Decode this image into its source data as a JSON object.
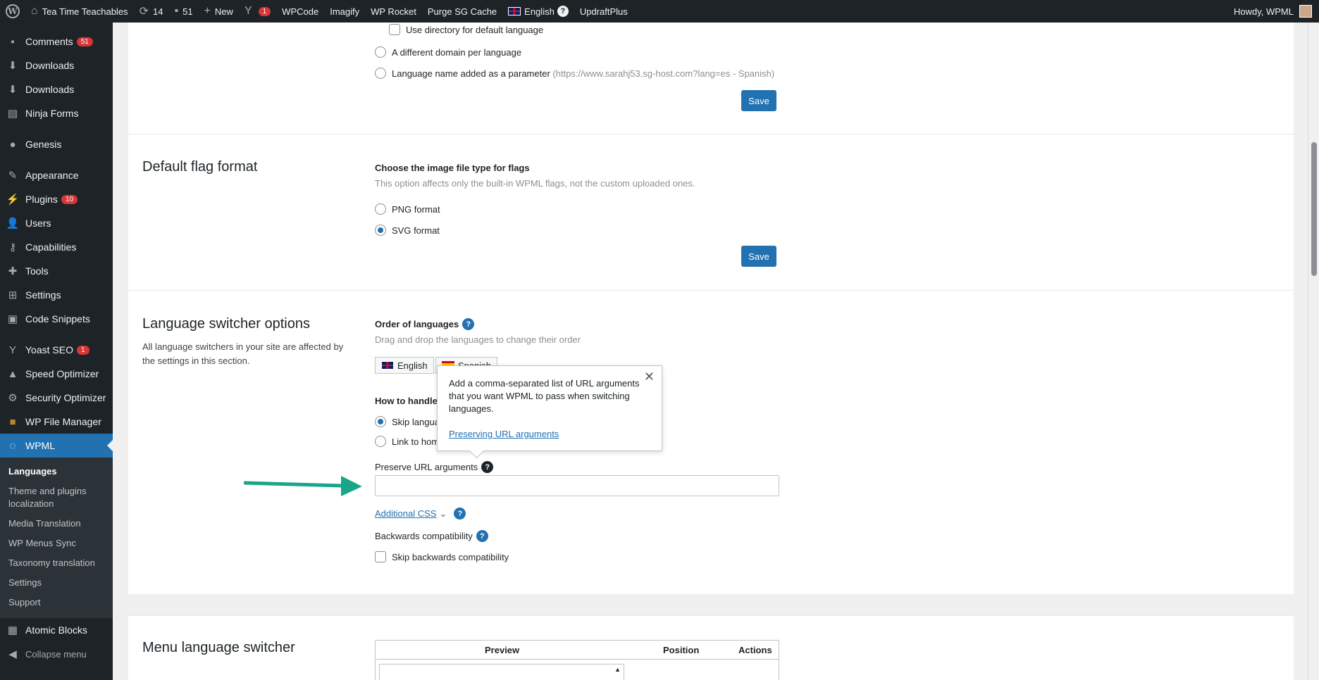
{
  "adminbar": {
    "site_name": "Tea Time Teachables",
    "updates_count": "14",
    "comments_count": "51",
    "new_label": "New",
    "yoast_count": "1",
    "items": [
      "WPCode",
      "Imagify",
      "WP Rocket",
      "Purge SG Cache"
    ],
    "language": "English",
    "updraft": "UpdraftPlus",
    "howdy": "Howdy, WPML"
  },
  "sidebar": {
    "items": [
      {
        "label": "Comments",
        "icon": "comments-icon",
        "badge": "51"
      },
      {
        "label": "Downloads",
        "icon": "download-icon"
      },
      {
        "label": "Downloads",
        "icon": "download-icon"
      },
      {
        "label": "Ninja Forms",
        "icon": "forms-icon"
      },
      {
        "label": "Genesis",
        "icon": "genesis-icon"
      },
      {
        "label": "Appearance",
        "icon": "appearance-icon"
      },
      {
        "label": "Plugins",
        "icon": "plugins-icon",
        "badge": "10"
      },
      {
        "label": "Users",
        "icon": "users-icon"
      },
      {
        "label": "Capabilities",
        "icon": "key-icon"
      },
      {
        "label": "Tools",
        "icon": "tools-icon"
      },
      {
        "label": "Settings",
        "icon": "settings-icon"
      },
      {
        "label": "Code Snippets",
        "icon": "code-icon"
      },
      {
        "label": "Yoast SEO",
        "icon": "yoast-icon",
        "badge": "1"
      },
      {
        "label": "Speed Optimizer",
        "icon": "speed-icon"
      },
      {
        "label": "Security Optimizer",
        "icon": "security-icon"
      },
      {
        "label": "WP File Manager",
        "icon": "folder-icon"
      },
      {
        "label": "WPML",
        "icon": "wpml-icon"
      }
    ],
    "submenu": [
      "Languages",
      "Theme and plugins localization",
      "Media Translation",
      "WP Menus Sync",
      "Taxonomy translation",
      "Settings",
      "Support"
    ],
    "atomic": "Atomic Blocks",
    "collapse": "Collapse menu"
  },
  "url_format": {
    "use_directory": "Use directory for default language",
    "different_domain": "A different domain per language",
    "param_label": "Language name added as a parameter",
    "param_hint": "(https://www.sarahj53.sg-host.com?lang=es - Spanish)",
    "save": "Save"
  },
  "flag_format": {
    "title": "Default flag format",
    "label": "Choose the image file type for flags",
    "note": "This option affects only the built-in WPML flags, not the custom uploaded ones.",
    "png": "PNG format",
    "svg": "SVG format",
    "save": "Save"
  },
  "switcher": {
    "title": "Language switcher options",
    "desc": "All language switchers in your site are affected by the settings in this section.",
    "order_label": "Order of languages",
    "order_note": "Drag and drop the languages to change their order",
    "lang1": "English",
    "lang2": "Spanish",
    "how_to_handle": "How to handle",
    "skip_lang": "Skip languag",
    "link_home": "Link to hom",
    "preserve_label": "Preserve URL arguments",
    "preserve_value": "",
    "additional_css": "Additional CSS",
    "backwards_label": "Backwards compatibility",
    "skip_backwards": "Skip backwards compatibility"
  },
  "tooltip": {
    "text": "Add a comma-separated list of URL arguments that you want WPML to pass when switching languages.",
    "link": "Preserving URL arguments"
  },
  "menu_switcher": {
    "title": "Menu language switcher",
    "columns": [
      "Preview",
      "Position",
      "Actions"
    ]
  }
}
